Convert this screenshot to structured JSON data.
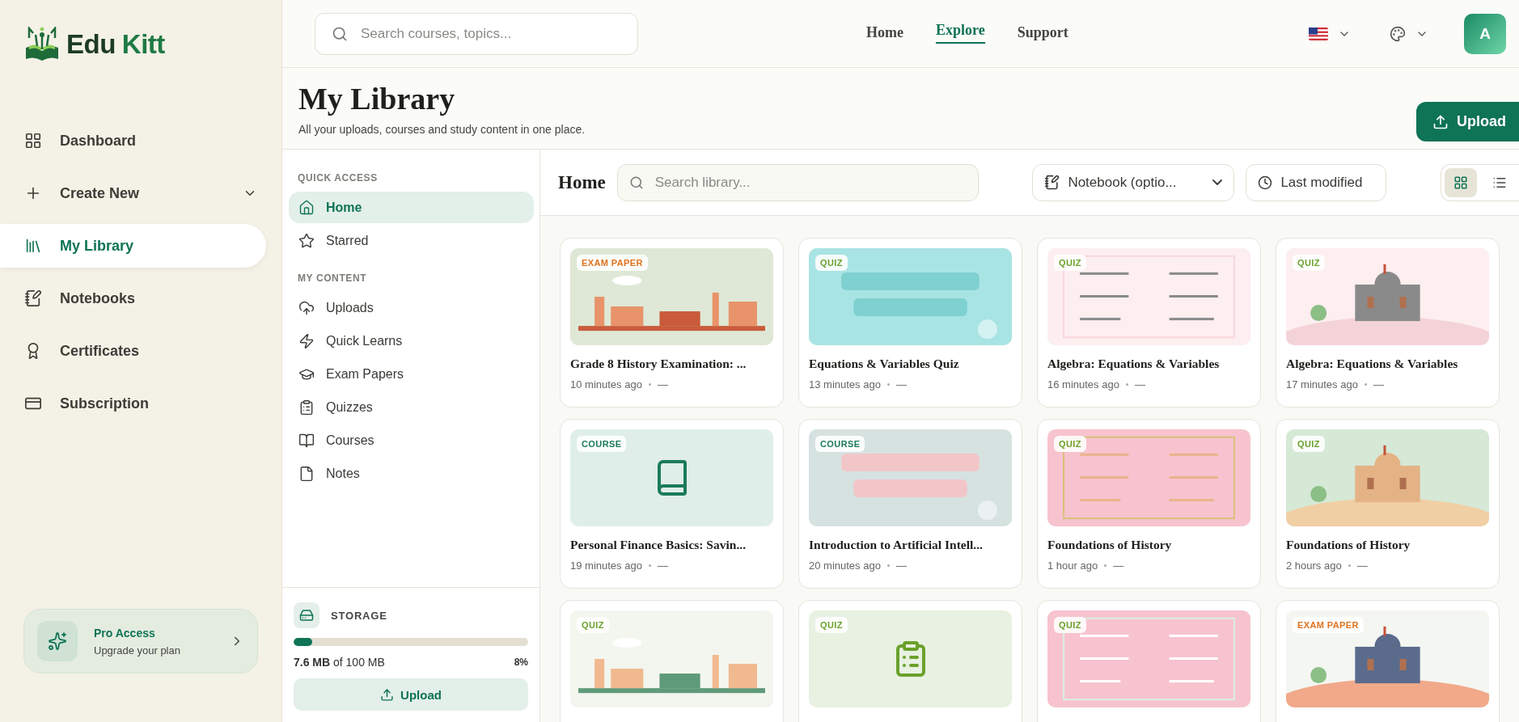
{
  "logo": {
    "words": [
      "Edu",
      "Kitt"
    ]
  },
  "sidebar": {
    "items": [
      {
        "label": "Dashboard",
        "selected": false
      },
      {
        "label": "Create New",
        "selected": false,
        "expanded": false
      },
      {
        "label": "My Library",
        "selected": true
      },
      {
        "label": "Notebooks",
        "selected": false
      },
      {
        "label": "Certificates",
        "selected": false
      },
      {
        "label": "Subscription",
        "selected": false
      }
    ],
    "promo": {
      "title": "Pro Access",
      "subtitle": "Upgrade your plan"
    }
  },
  "topbar": {
    "search": {
      "placeholder": "Search courses, topics..."
    },
    "nav": [
      {
        "label": "Home",
        "selected": false
      },
      {
        "label": "Explore",
        "selected": true
      },
      {
        "label": "Support",
        "selected": false
      }
    ],
    "avatar": "A"
  },
  "header": {
    "title": "My Library",
    "subtitle": "All your uploads, courses and study content in one place.",
    "upload_button": "Upload"
  },
  "library_nav": {
    "sections": [
      {
        "heading": "QUICK ACCESS",
        "items": [
          {
            "label": "Home",
            "selected": true
          },
          {
            "label": "Starred",
            "selected": false
          }
        ]
      },
      {
        "heading": "MY CONTENT",
        "items": [
          {
            "label": "Uploads",
            "selected": false
          },
          {
            "label": "Quick Learns",
            "selected": false
          },
          {
            "label": "Exam Papers",
            "selected": false
          },
          {
            "label": "Quizzes",
            "selected": false
          },
          {
            "label": "Courses",
            "selected": false
          },
          {
            "label": "Notes",
            "selected": false
          }
        ]
      }
    ],
    "storage": {
      "label": "STORAGE",
      "level": 0.08,
      "usage": "**7.6 MB** of 100 MB",
      "percent": "8%",
      "upload_button": "Upload"
    }
  },
  "toolbar": {
    "title": "Home",
    "search": {
      "placeholder": "Search library..."
    },
    "notebook_select": "Notebook (optio...",
    "sort_button": "Last modified",
    "views": [
      {
        "kind": "grid",
        "selected": true
      },
      {
        "kind": "list",
        "selected": false
      }
    ]
  },
  "cards": [
    {
      "badge": {
        "label": "EXAM PAPER",
        "kind": "exam"
      },
      "title": "Grade 8 History Examination: ...",
      "time": "10 minutes ago",
      "detail": "—"
    },
    {
      "badge": {
        "label": "QUIZ",
        "kind": "quiz"
      },
      "title": "Equations & Variables Quiz",
      "time": "13 minutes ago",
      "detail": "—"
    },
    {
      "badge": {
        "label": "QUIZ",
        "kind": "quiz"
      },
      "title": "Algebra: Equations & Variables",
      "time": "16 minutes ago",
      "detail": "—"
    },
    {
      "badge": {
        "label": "QUIZ",
        "kind": "quiz"
      },
      "title": "Algebra: Equations & Variables",
      "time": "17 minutes ago",
      "detail": "—"
    },
    {
      "badge": {
        "label": "COURSE",
        "kind": "course"
      },
      "thumb": {
        "kind": "book"
      },
      "title": "Personal Finance Basics: Savin...",
      "time": "19 minutes ago",
      "detail": "—"
    },
    {
      "badge": {
        "label": "COURSE",
        "kind": "course"
      },
      "title": "Introduction to Artificial Intell...",
      "time": "20 minutes ago",
      "detail": "—"
    },
    {
      "badge": {
        "label": "QUIZ",
        "kind": "quiz"
      },
      "title": "Foundations of History",
      "time": "1 hour ago",
      "detail": "—"
    },
    {
      "badge": {
        "label": "QUIZ",
        "kind": "quiz"
      },
      "title": "Foundations of History",
      "time": "2 hours ago",
      "detail": "—"
    },
    {
      "badge": {
        "label": "QUIZ",
        "kind": "quiz"
      }
    },
    {
      "badge": {
        "label": "QUIZ",
        "kind": "quiz"
      },
      "thumb": {
        "kind": "clipboard"
      }
    },
    {
      "badge": {
        "label": "QUIZ",
        "kind": "quiz"
      }
    },
    {
      "badge": {
        "label": "EXAM PAPER",
        "kind": "exam"
      }
    }
  ]
}
